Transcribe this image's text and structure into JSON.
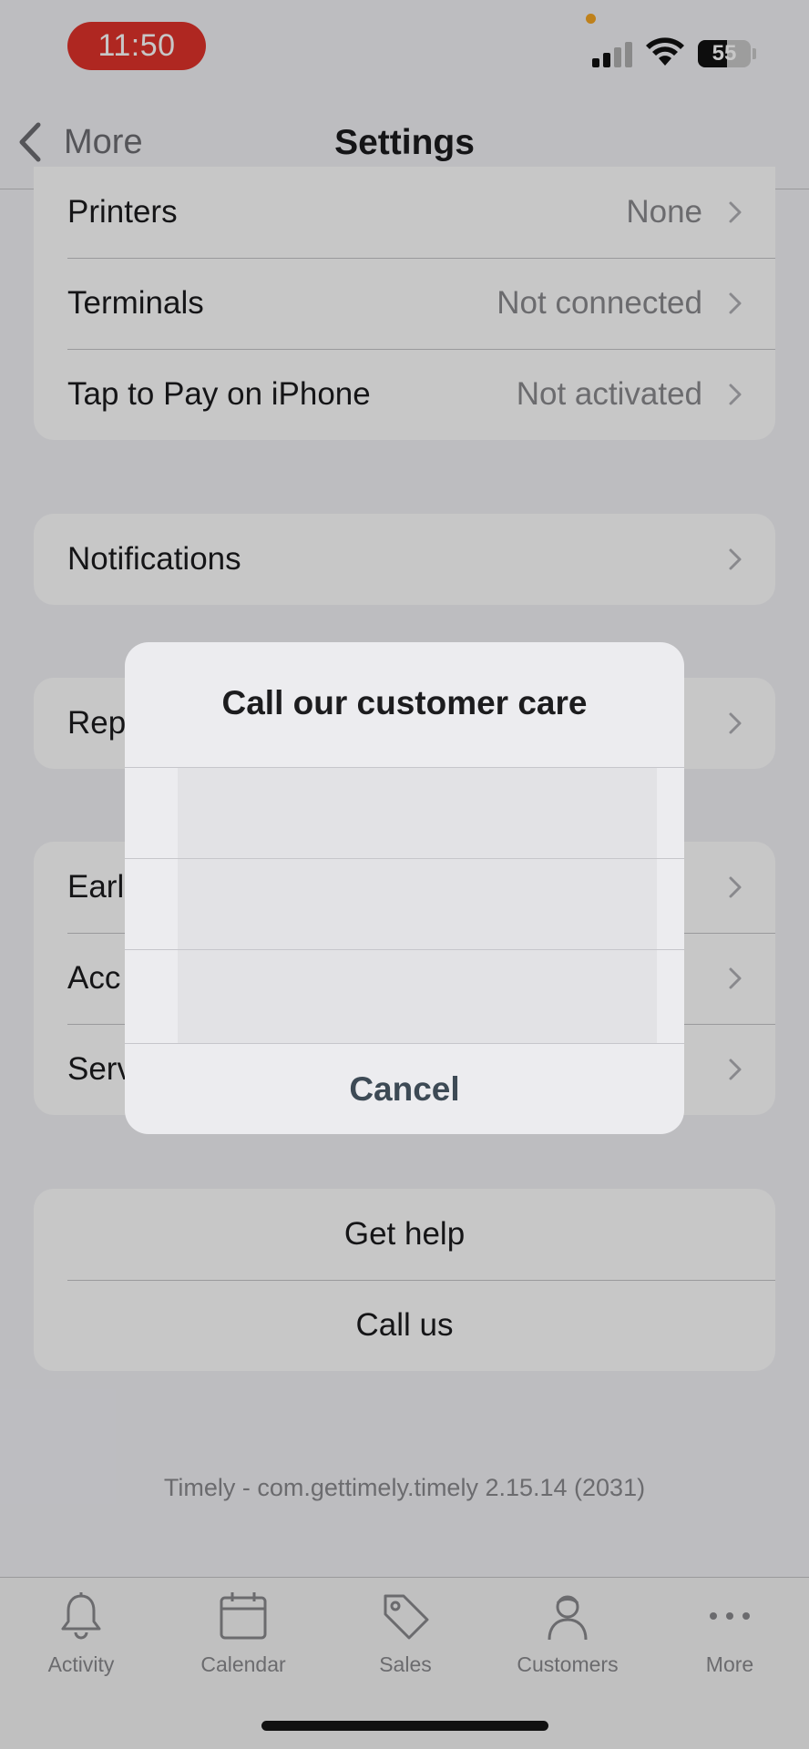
{
  "status_bar": {
    "time": "11:50",
    "battery": "55",
    "battery_level_percent": 55,
    "time_pill_color": "#e0322b"
  },
  "nav": {
    "back_label": "More",
    "title": "Settings"
  },
  "hardware_group": [
    {
      "label": "Printers",
      "value": "None"
    },
    {
      "label": "Terminals",
      "value": "Not connected"
    },
    {
      "label": "Tap to Pay on iPhone",
      "value": "Not activated"
    }
  ],
  "notifications_group": [
    {
      "label": "Notifications"
    }
  ],
  "reports_group": [
    {
      "label": "Rep"
    }
  ],
  "misc_group": [
    {
      "label": "Earl"
    },
    {
      "label": "Acc"
    },
    {
      "label": "Serv"
    }
  ],
  "help_group": [
    {
      "label": "Get help"
    },
    {
      "label": "Call us"
    }
  ],
  "version_text": "Timely - com.gettimely.timely 2.15.14 (2031)",
  "tabs": [
    {
      "label": "Activity",
      "icon": "bell-icon"
    },
    {
      "label": "Calendar",
      "icon": "calendar-icon"
    },
    {
      "label": "Sales",
      "icon": "tag-icon"
    },
    {
      "label": "Customers",
      "icon": "person-icon"
    },
    {
      "label": "More",
      "icon": "more-icon"
    }
  ],
  "dialog": {
    "title": "Call our customer care",
    "options": [
      "",
      "",
      ""
    ],
    "cancel_label": "Cancel"
  }
}
